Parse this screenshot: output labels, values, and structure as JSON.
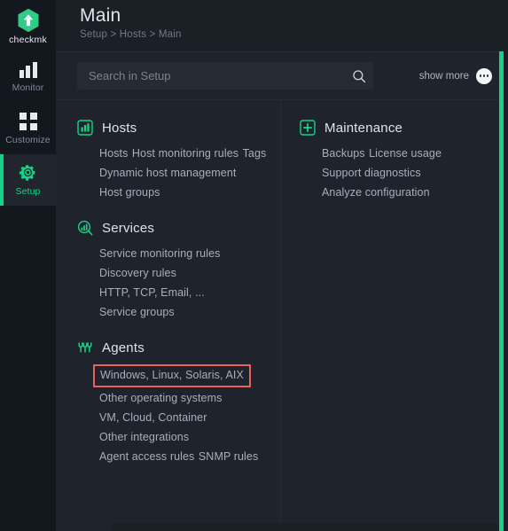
{
  "sidebar": {
    "logo": {
      "name": "checkmk-logo",
      "label": "checkmk"
    },
    "items": [
      {
        "icon": "bar-chart-icon",
        "label": "Monitor",
        "active": false
      },
      {
        "icon": "grid-icon",
        "label": "Customize",
        "active": false
      },
      {
        "icon": "gear-icon",
        "label": "Setup",
        "active": true
      }
    ]
  },
  "header": {
    "title": "Main",
    "breadcrumb": "Setup > Hosts > Main"
  },
  "search": {
    "placeholder": "Search in Setup",
    "value": "",
    "icon": "search-icon"
  },
  "show_more": {
    "label": "show more",
    "icon": "ellipsis-icon"
  },
  "columns": {
    "left": [
      {
        "title": "Hosts",
        "icon": "hosts-bar-chart-icon",
        "items": [
          {
            "label": "Hosts",
            "highlighted": false
          },
          {
            "label": "Host monitoring rules",
            "highlighted": false
          },
          {
            "label": "Tags",
            "highlighted": false
          },
          {
            "label": "Dynamic host management",
            "highlighted": false
          },
          {
            "label": "Host groups",
            "highlighted": false
          }
        ]
      },
      {
        "title": "Services",
        "icon": "services-magnifier-icon",
        "items": [
          {
            "label": "Service monitoring rules",
            "highlighted": false
          },
          {
            "label": "Discovery rules",
            "highlighted": false
          },
          {
            "label": "HTTP, TCP, Email, ...",
            "highlighted": false
          },
          {
            "label": "Service groups",
            "highlighted": false
          }
        ]
      },
      {
        "title": "Agents",
        "icon": "agents-plug-icon",
        "items": [
          {
            "label": "Windows, Linux, Solaris, AIX",
            "highlighted": true
          },
          {
            "label": "Other operating systems",
            "highlighted": false
          },
          {
            "label": "VM, Cloud, Container",
            "highlighted": false
          },
          {
            "label": "Other integrations",
            "highlighted": false
          },
          {
            "label": "Agent access rules",
            "highlighted": false
          },
          {
            "label": "SNMP rules",
            "highlighted": false
          }
        ]
      }
    ],
    "right": [
      {
        "title": "Maintenance",
        "icon": "maintenance-plus-icon",
        "items": [
          {
            "label": "Backups",
            "highlighted": false
          },
          {
            "label": "License usage",
            "highlighted": false
          },
          {
            "label": "Support diagnostics",
            "highlighted": false
          },
          {
            "label": "Analyze configuration",
            "highlighted": false
          }
        ]
      }
    ]
  },
  "colors": {
    "accent_green": "#13d389",
    "highlight_red": "#e8615a",
    "sidebar_bg": "#13171e",
    "main_bg": "#1f242c"
  }
}
